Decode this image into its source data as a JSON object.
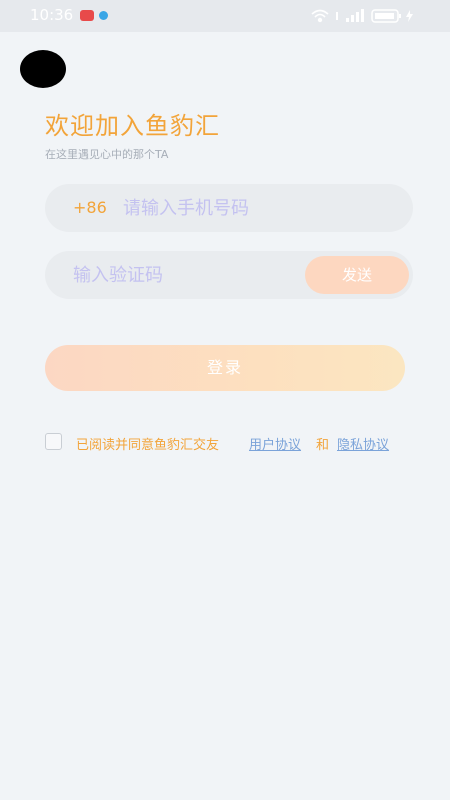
{
  "status_bar": {
    "time": "10:36",
    "battery_label": "92"
  },
  "header": {
    "title": "欢迎加入鱼豹汇",
    "subtitle": "在这里遇见心中的那个TA"
  },
  "phone": {
    "country_code": "+86",
    "placeholder": "请输入手机号码"
  },
  "code": {
    "placeholder": "输入验证码",
    "send_label": "发送"
  },
  "login": {
    "label": "登录"
  },
  "agreement": {
    "prefix": "已阅读并同意鱼豹汇交友",
    "user_agreement": "用户协议",
    "and": "和",
    "privacy_policy": "隐私协议",
    "checked": false
  },
  "colors": {
    "accent": "#f2a43a",
    "link": "#7ba3d9",
    "placeholder": "#c4c2f0",
    "button_start": "#fcd7c3",
    "button_end": "#fbe6c1"
  },
  "icons": [
    "back-icon",
    "wifi-icon",
    "signal-icon",
    "battery-icon",
    "notification-icon"
  ]
}
